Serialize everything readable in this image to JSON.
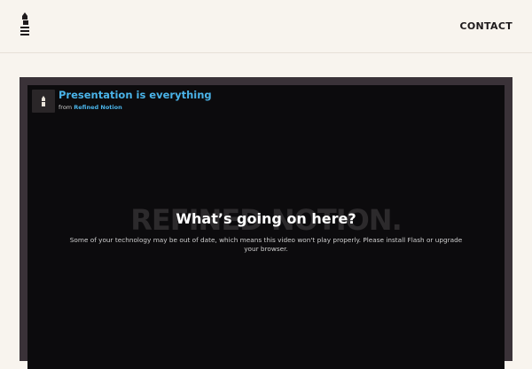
{
  "header": {
    "logo_icon": "lighthouse-logo-icon",
    "contact_label": "CONTACT"
  },
  "video": {
    "title": "Presentation is everything",
    "byline_prefix": "from",
    "owner": "Refined Notion",
    "watermark": "REFINED NOTION.",
    "error_heading": "What’s going on here?",
    "error_message": "Some of your technology may be out of date, which means this video won't play properly. Please install Flash or upgrade your browser."
  },
  "colors": {
    "background": "#f8f4ee",
    "frame": "#3a3238",
    "player": "#0c0b0d",
    "link": "#4ab3e8"
  }
}
